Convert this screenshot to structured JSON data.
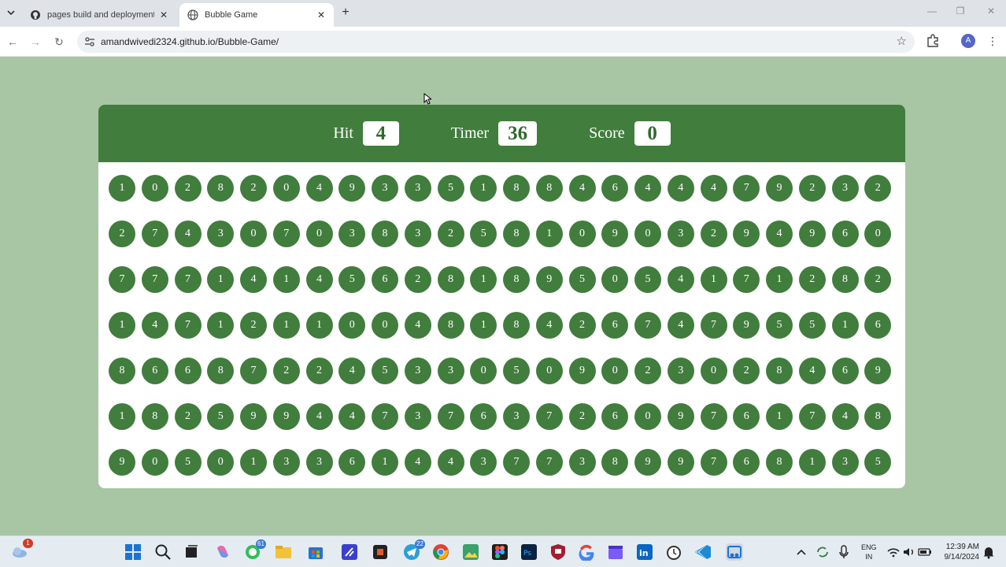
{
  "browser": {
    "tabs": [
      {
        "title": "pages build and deployment · A",
        "active": false
      },
      {
        "title": "Bubble Game",
        "active": true
      }
    ],
    "url": "amandwivedi2324.github.io/Bubble-Game/",
    "profile_initial": "A"
  },
  "game": {
    "hit_label": "Hit",
    "hit_value": "4",
    "timer_label": "Timer",
    "timer_value": "36",
    "score_label": "Score",
    "score_value": "0",
    "bubbles": [
      "1",
      "0",
      "2",
      "8",
      "2",
      "0",
      "4",
      "9",
      "3",
      "3",
      "5",
      "1",
      "8",
      "8",
      "4",
      "6",
      "4",
      "4",
      "4",
      "7",
      "9",
      "2",
      "3",
      "2",
      "2",
      "7",
      "4",
      "3",
      "0",
      "7",
      "0",
      "3",
      "8",
      "3",
      "2",
      "5",
      "8",
      "1",
      "0",
      "9",
      "0",
      "3",
      "2",
      "9",
      "4",
      "9",
      "6",
      "0",
      "7",
      "7",
      "7",
      "1",
      "4",
      "1",
      "4",
      "5",
      "6",
      "2",
      "8",
      "1",
      "8",
      "9",
      "5",
      "0",
      "5",
      "4",
      "1",
      "7",
      "1",
      "2",
      "8",
      "2",
      "1",
      "4",
      "7",
      "1",
      "2",
      "1",
      "1",
      "0",
      "0",
      "4",
      "8",
      "1",
      "8",
      "4",
      "2",
      "6",
      "7",
      "4",
      "7",
      "9",
      "5",
      "5",
      "1",
      "6",
      "8",
      "6",
      "6",
      "8",
      "7",
      "2",
      "2",
      "4",
      "5",
      "3",
      "3",
      "0",
      "5",
      "0",
      "9",
      "0",
      "2",
      "3",
      "0",
      "2",
      "8",
      "4",
      "6",
      "9",
      "1",
      "8",
      "2",
      "5",
      "9",
      "9",
      "4",
      "4",
      "7",
      "3",
      "7",
      "6",
      "3",
      "7",
      "2",
      "6",
      "0",
      "9",
      "7",
      "6",
      "1",
      "7",
      "4",
      "8",
      "9",
      "0",
      "5",
      "0",
      "1",
      "3",
      "3",
      "6",
      "1",
      "4",
      "4",
      "3",
      "7",
      "7",
      "3",
      "8",
      "9",
      "9",
      "7",
      "6",
      "8",
      "1",
      "3",
      "5"
    ]
  },
  "taskbar": {
    "weather_badge": "1",
    "whatsapp_badge": "61",
    "telegram_badge": "22",
    "lang_line1": "ENG",
    "lang_line2": "IN",
    "time": "12:39 AM",
    "date": "9/14/2024"
  }
}
